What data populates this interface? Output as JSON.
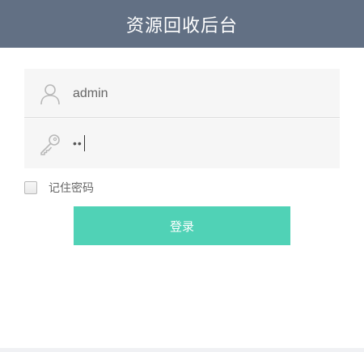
{
  "header": {
    "title": "资源回收后台"
  },
  "form": {
    "username": {
      "value": "admin",
      "icon": "user-icon"
    },
    "password": {
      "masked_value": "••",
      "icon": "key-icon"
    },
    "remember": {
      "label": "记住密码",
      "checked": false
    },
    "submit": {
      "label": "登录"
    }
  },
  "colors": {
    "header_bg": "#627084",
    "button_bg": "#50d2b6",
    "field_bg": "#f6f6f6"
  }
}
